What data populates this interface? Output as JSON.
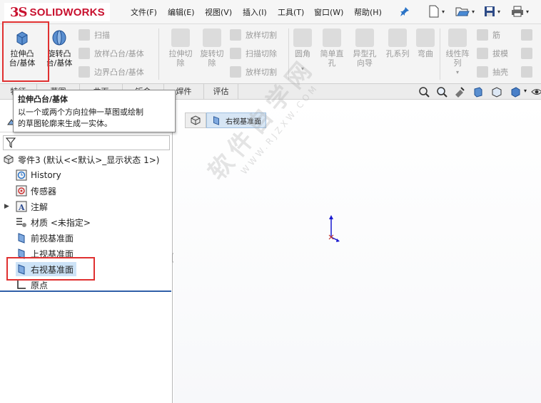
{
  "app": {
    "logo_ds": "3S",
    "logo_text": "SOLIDWORKS",
    "brand_color": "#c8102e"
  },
  "menubar": {
    "items": [
      "文件(F)",
      "编辑(E)",
      "视图(V)",
      "插入(I)",
      "工具(T)",
      "窗口(W)",
      "帮助(H)"
    ]
  },
  "ribbon": {
    "extrude_boss": "拉伸凸\n台/基体",
    "revolve_boss": "旋转凸\n台/基体",
    "sweep": "扫描",
    "loft_boss": "放样凸台/基体",
    "boundary_boss": "边界凸台/基体",
    "extrude_cut": "拉伸切\n除",
    "revolve_cut": "旋转切\n除",
    "loft_cut": "放样切割",
    "sweep_cut": "扫描切除",
    "boundary_cut": "放样切割",
    "fillet": "圆角",
    "simple_hole": "简单直\n孔",
    "hole_wizard": "异型孔\n向导",
    "hole_series": "孔系列",
    "wrap": "弯曲",
    "linear_pattern": "线性阵\n列",
    "rib": "筋",
    "draft": "拔模",
    "shell": "抽壳"
  },
  "tabs": {
    "items": [
      "特征",
      "草图",
      "曲面",
      "钣金",
      "焊件",
      "评估"
    ]
  },
  "tooltip": {
    "title": "拉伸凸台/基体",
    "line1": "以一个或两个方向拉伸一草图或绘制",
    "line2": "的草图轮廓来生成一实体。"
  },
  "tree": {
    "root": "零件3  (默认<<默认>_显示状态 1>)",
    "history": "History",
    "sensors": "传感器",
    "annotations": "注解",
    "material": "材质 <未指定>",
    "front_plane": "前视基准面",
    "top_plane": "上视基准面",
    "right_plane": "右视基准面",
    "origin": "原点"
  },
  "breadcrumb": {
    "label": "右视基准面"
  },
  "watermark": {
    "text": "软件自学网",
    "url": "WWW.RJZXW.COM"
  },
  "colors": {
    "highlight": "#e03030",
    "selected": "#cde3f7",
    "axis": "#1a1ad0"
  }
}
